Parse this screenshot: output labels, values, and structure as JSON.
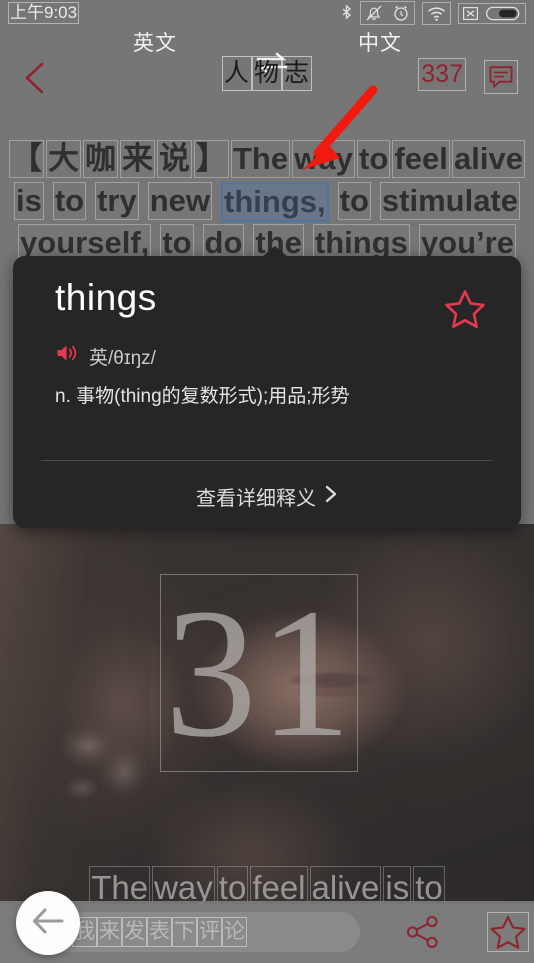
{
  "status_bar": {
    "time": "上午9:03",
    "icons": [
      "bluetooth-icon",
      "mute-bell-icon",
      "alarm-clock-icon",
      "wifi-icon",
      "no-signal-icon",
      "battery-icon"
    ]
  },
  "language_bar": {
    "source": "英文",
    "swap_icon": "swap-arrows-icon",
    "target": "中文"
  },
  "nav_bar": {
    "back_icon": "back-chevron-icon",
    "title": "人物志",
    "title_chars": [
      "人",
      "物",
      "志"
    ],
    "comment_count": "337",
    "comment_icon": "comment-bubble-icon"
  },
  "article": {
    "lines": [
      [
        {
          "t": "【",
          "cjk": true,
          "sel": false
        },
        {
          "t": "大",
          "cjk": true,
          "sel": false
        },
        {
          "t": "咖",
          "cjk": true,
          "sel": false
        },
        {
          "t": "来",
          "cjk": true,
          "sel": false
        },
        {
          "t": "说",
          "cjk": true,
          "sel": false
        },
        {
          "t": "】",
          "cjk": true,
          "sel": false
        },
        {
          "t": "The",
          "cjk": false,
          "sel": false
        },
        {
          "t": "way",
          "cjk": false,
          "sel": false
        },
        {
          "t": "to",
          "cjk": false,
          "sel": false
        },
        {
          "t": "feel",
          "cjk": false,
          "sel": false
        },
        {
          "t": "alive",
          "cjk": false,
          "sel": false
        }
      ],
      [
        {
          "t": "is",
          "cjk": false,
          "sel": false
        },
        {
          "t": "to",
          "cjk": false,
          "sel": false
        },
        {
          "t": "try",
          "cjk": false,
          "sel": false
        },
        {
          "t": "new",
          "cjk": false,
          "sel": false
        },
        {
          "t": "things,",
          "cjk": false,
          "sel": true
        },
        {
          "t": "to",
          "cjk": false,
          "sel": false
        },
        {
          "t": "stimulate",
          "cjk": false,
          "sel": false
        }
      ],
      [
        {
          "t": "yourself,",
          "cjk": false,
          "sel": false
        },
        {
          "t": "to",
          "cjk": false,
          "sel": false
        },
        {
          "t": "do",
          "cjk": false,
          "sel": false
        },
        {
          "t": "the",
          "cjk": false,
          "sel": false
        },
        {
          "t": "things",
          "cjk": false,
          "sel": false
        },
        {
          "t": "you’re",
          "cjk": false,
          "sel": false
        }
      ]
    ]
  },
  "popup": {
    "word": "things",
    "star_icon": "star-outline-icon",
    "speaker_icon": "speaker-icon",
    "phonetic": "英/θɪŋz/",
    "definition": "n. 事物(thing的复数形式);用品;形势",
    "more_label": "查看详细释义",
    "more_icon": "chevron-right-icon"
  },
  "photo": {
    "number": "31",
    "caption_tokens": [
      "The",
      "way",
      "to",
      "feel",
      "alive",
      "is",
      "to"
    ]
  },
  "bottom_bar": {
    "comment_placeholder": "我来发表下评论",
    "comment_placeholder_chars": [
      "我",
      "来",
      "发",
      "表",
      "下",
      "评",
      "论"
    ],
    "share_icon": "share-icon",
    "favorite_icon": "star-outline-icon",
    "fab_icon": "back-arrow-icon"
  },
  "annotation": {
    "arrow_icon": "red-pointer-arrow",
    "color": "#f01b0e"
  },
  "colors": {
    "accent_red": "#e8384f",
    "nav_red": "#8f2430",
    "selection_blue": "#4a86d8",
    "popup_bg": "#262626",
    "page_bg": "#8a8a8a"
  }
}
